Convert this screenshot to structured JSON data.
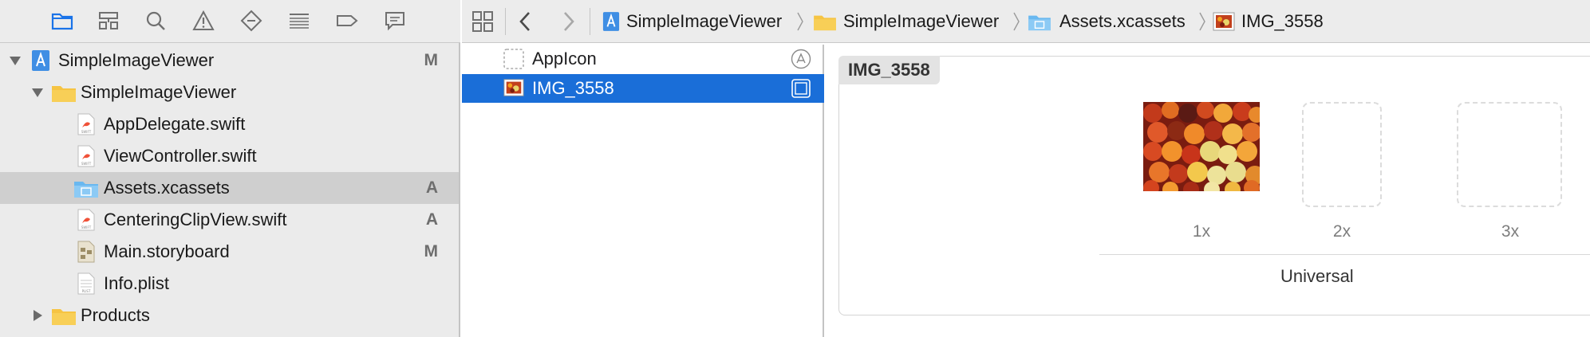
{
  "navigator": {
    "toolbar_icons": [
      "folder-icon",
      "hierarchy-icon",
      "search-icon",
      "warning-icon",
      "diamond-icon",
      "list-icon",
      "tag-icon",
      "speech-bubble-icon"
    ],
    "items": [
      {
        "label": "SimpleImageViewer",
        "badge": "M",
        "icon": "xcode-project-icon",
        "expanded": true
      },
      {
        "label": "SimpleImageViewer",
        "badge": "",
        "icon": "folder-icon",
        "expanded": true
      },
      {
        "label": "AppDelegate.swift",
        "badge": "",
        "icon": "swift-file-icon"
      },
      {
        "label": "ViewController.swift",
        "badge": "",
        "icon": "swift-file-icon"
      },
      {
        "label": "Assets.xcassets",
        "badge": "A",
        "icon": "asset-catalog-icon",
        "selected": true
      },
      {
        "label": "CenteringClipView.swift",
        "badge": "A",
        "icon": "swift-file-icon"
      },
      {
        "label": "Main.storyboard",
        "badge": "M",
        "icon": "storyboard-icon"
      },
      {
        "label": "Info.plist",
        "badge": "",
        "icon": "plist-file-icon"
      },
      {
        "label": "Products",
        "badge": "",
        "icon": "folder-icon",
        "expanded": false
      }
    ]
  },
  "jumpbar": {
    "crumbs": [
      "SimpleImageViewer",
      "SimpleImageViewer",
      "Assets.xcassets",
      "IMG_3558"
    ]
  },
  "asset_list": {
    "items": [
      {
        "label": "AppIcon",
        "icon": "app-icon-placeholder-icon",
        "selected": false
      },
      {
        "label": "IMG_3558",
        "icon": "image-thumbnail-icon",
        "selected": true
      }
    ]
  },
  "detail": {
    "set_name": "IMG_3558",
    "slots": [
      "1x",
      "2x",
      "3x"
    ],
    "group_label": "Universal"
  },
  "colors": {
    "selection_blue": "#1a6ed8",
    "folder_yellow": "#f6c443",
    "xcode_blue": "#3f8ee4"
  }
}
